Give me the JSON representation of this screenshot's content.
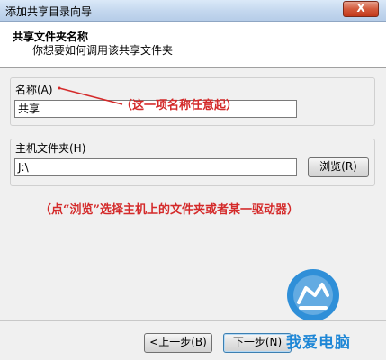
{
  "window": {
    "title": "添加共享目录向导",
    "close_glyph": "X"
  },
  "header": {
    "title": "共享文件夹名称",
    "subtitle": "你想要如何调用该共享文件夹"
  },
  "name_section": {
    "label": "名称(A)",
    "value": "共享"
  },
  "host_section": {
    "label": "主机文件夹(H)",
    "value": "J:\\",
    "browse_label": "浏览(R)"
  },
  "annotations": {
    "name_hint": "（这一项名称任意起）",
    "browse_hint": "（点“浏览”选择主机上的文件夹或者某一驱动器）"
  },
  "footer": {
    "back_label": "<上一步(B)",
    "next_label": "下一步(N)"
  },
  "watermark": {
    "text": "我爱电脑"
  },
  "colors": {
    "annotation": "#d42a2a",
    "watermark": "#1f87d6"
  }
}
